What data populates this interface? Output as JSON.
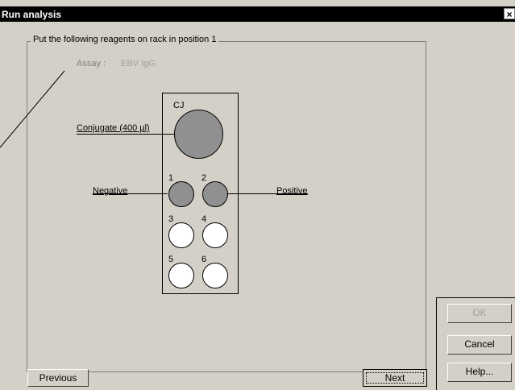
{
  "window": {
    "title": "Run analysis",
    "close_glyph": "×"
  },
  "group": {
    "legend": "Put the following reagents on rack in position 1"
  },
  "assay": {
    "label": "Assay :",
    "value": "EBV IgG"
  },
  "rack": {
    "positions": {
      "cj": "CJ",
      "p1": "1",
      "p2": "2",
      "p3": "3",
      "p4": "4",
      "p5": "5",
      "p6": "6"
    },
    "reagents": {
      "conjugate": "Conjugate (400 µl)",
      "negative": "Negative",
      "positive": "Positive"
    }
  },
  "buttons": {
    "previous": "Previous",
    "next": "Next",
    "ok": "OK",
    "cancel": "Cancel",
    "help": "Help..."
  },
  "colors": {
    "filled_well": "#909090",
    "empty_well": "#ffffff",
    "dialog_bg": "#d4d0c8"
  }
}
